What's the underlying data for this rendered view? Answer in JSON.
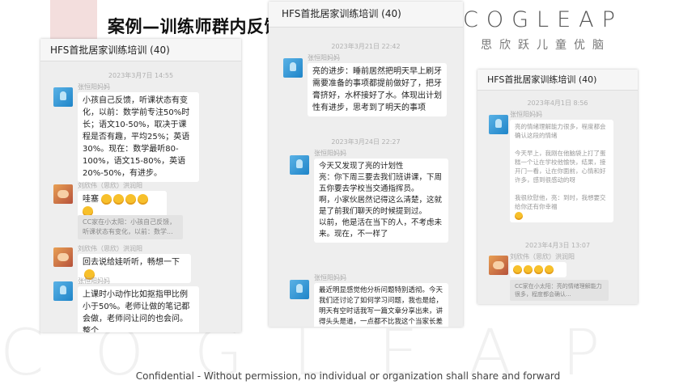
{
  "slide": {
    "title": "案例—训练师群内反馈",
    "logo_word": "COGLEAP",
    "logo_sub": "思欣跃儿童优脑",
    "watermark": "COGLEAP",
    "footer": "Confidential - Without permission, no individual or organization shall share and forward"
  },
  "panel_left": {
    "group_name": "HFS首批居家训练培训 (40)",
    "timestamp_1": "2023年3月7日 14:55",
    "sender_1": "张恒阳妈妈",
    "msg_1": "小孩自己反馈，听课状态有变化，以前：数学前专注50%时长；语文10-50%，取决于课程是否有趣，平均25%；英语30%。现在：数学最听80-100%，语文15-80%，英语20%-50%，有进步。",
    "sender_2": "刘欣伟（思欣）洪润阳",
    "msg_2": "哇塞",
    "quote_2": "CC家在小太阳：小孩自己反馈，听课状态有变化，以前：数学...",
    "sender_3": "刘欣伟（思欣）洪润阳",
    "msg_3": "回去说给娃听听，畅想一下",
    "sender_4": "张恒阳妈妈",
    "msg_4": "上课时小动作比如抠指甲比例小于50%。老师让做的笔记都会做，老师问让问的也会问。整个"
  },
  "panel_mid": {
    "group_name": "HFS首批居家训练培训 (40)",
    "timestamp_1": "2023年3月21日 22:42",
    "sender_1": "张恒阳妈妈",
    "msg_1": "亮的进步：睡前居然把明天早上刷牙需要准备的事项都提前做好了，把牙膏挤好，水杯接好了水。体现出计划性有进步，思考到了明天的事项",
    "timestamp_2": "2023年3月24日 22:27",
    "sender_2": "张恒阳妈妈",
    "msg_2": "今天又发现了亮的计划性\n亮：你下周三要去我们班讲课，下周五你要去学校当交通指挥员。\n啊，小家伙居然记得这么清楚，这就是了前我们聊天的时候提到过。\n以前，他是活在当下的人，不考虑未来。现在，不一样了",
    "sender_3": "张恒阳妈妈",
    "msg_3": "最近明显感觉他分析问题特别透彻。今天我们还讨论了如何学习问题，我也是给，明天有空时话我写一篇文章分享出来，讲得头头是道，一点都不比我这个当家长差"
  },
  "panel_right": {
    "group_name": "HFS首批居家训练培训 (40)",
    "timestamp_1": "2023年4月1日 8:56",
    "sender_1": "张恒阳妈妈",
    "msg_1": "亮的情绪理解能力很多，程度都会确认这段的情绪\n\n今天早上，我刚在他脑袋上打了蛋糕一个让在学校他愉快，结果，接开门一看，让在你面前，心情和好许多，感到很感动的呀\n\n我很欣慰他，亮：到时，我想要交给你还有你幸福",
    "timestamp_2": "2023年4月3日 13:07",
    "sender_2": "刘欣伟（思欣）洪润阳",
    "quote_2": "CC家在小太阳：亮的情绪理解能力很多，程度都会确认..."
  }
}
